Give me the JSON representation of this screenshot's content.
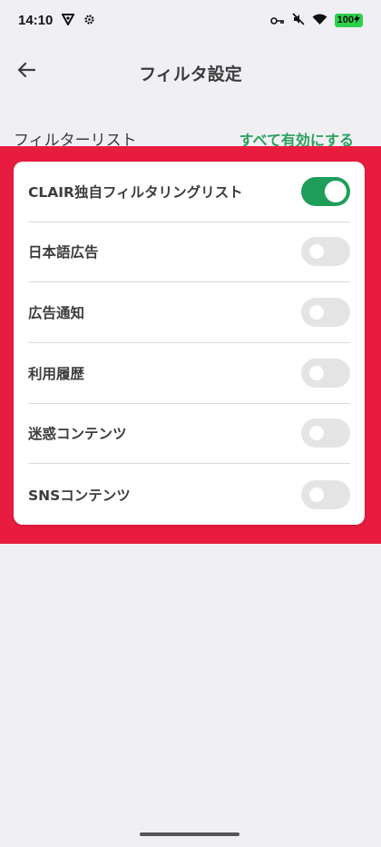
{
  "status_bar": {
    "time": "14:10",
    "battery": "100"
  },
  "header": {
    "title": "フィルタ設定"
  },
  "section": {
    "title": "フィルターリスト",
    "enable_all_label": "すべて有効にする"
  },
  "filters": [
    {
      "label": "CLAIR独自フィルタリングリスト",
      "enabled": true
    },
    {
      "label": "日本語広告",
      "enabled": false
    },
    {
      "label": "広告通知",
      "enabled": false
    },
    {
      "label": "利用履歴",
      "enabled": false
    },
    {
      "label": "迷惑コンテンツ",
      "enabled": false
    },
    {
      "label": "SNSコンテンツ",
      "enabled": false
    }
  ],
  "colors": {
    "accent": "#2aa05d",
    "toggle_on": "#1f9e59",
    "toggle_off": "#e4e4e4",
    "highlight": "#e81c3f",
    "background": "#f0eff4"
  }
}
